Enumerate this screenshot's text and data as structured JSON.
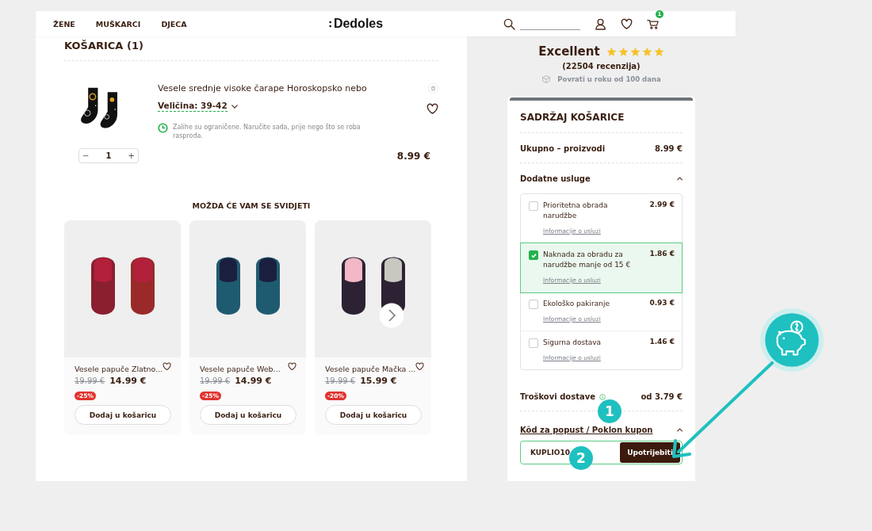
{
  "header": {
    "nav": [
      "ŽENE",
      "MUŠKARCI",
      "DJECA"
    ],
    "logo": "Dedoles",
    "cart_count": "1"
  },
  "cart": {
    "title": "KOŠARICA (1)",
    "item": {
      "name": "Vesele srednje visoke čarape Horoskopsko nebo",
      "size": "Veličina: 39-42",
      "stock_note": "Zalihe su ograničene. Naručite sada, prije nego što se roba rasproda.",
      "quantity": "1",
      "minus": "−",
      "plus": "+",
      "price": "8.99 €"
    }
  },
  "recommendations": {
    "title": "MOŽDA ĆE VAM SE SVIDJETI",
    "products": [
      {
        "name": "Vesele papuče Zlatno...",
        "old_price": "19.99 €",
        "price": "14.99 €",
        "discount": "-25%",
        "button": "Dodaj u košaricu"
      },
      {
        "name": "Vesele papuče Web...",
        "old_price": "19.99 €",
        "price": "14.99 €",
        "discount": "-25%",
        "button": "Dodaj u košaricu"
      },
      {
        "name": "Vesele papuče Mačka ...",
        "old_price": "19.99 €",
        "price": "15.99 €",
        "discount": "-20%",
        "button": "Dodaj u košaricu"
      }
    ]
  },
  "sidebar": {
    "rating": {
      "label": "Excellent",
      "stars": 5,
      "reviews": "(22504 recenzija)",
      "returns": "Povrati u roku od 100 dana"
    },
    "summary": {
      "title": "SADRŽAJ KOŠARICE",
      "subtotal_label": "Ukupno – proizvodi",
      "subtotal": "8.99 €",
      "services_label": "Dodatne usluge",
      "services_expanded": true,
      "services": [
        {
          "name": "Prioritetna obrada narudžbe",
          "price": "2.99 €",
          "info": "Informacije o usluzi",
          "checked": false
        },
        {
          "name": "Naknada za obradu za narudžbe manje od 15 €",
          "price": "1.86 €",
          "info": "Informacije o usluzi",
          "checked": true
        },
        {
          "name": "Ekološko pakiranje",
          "price": "0.93 €",
          "info": "Informacije o usluzi",
          "checked": false
        },
        {
          "name": "Sigurna dostava",
          "price": "1.46 €",
          "info": "Informacije o usluzi",
          "checked": false
        }
      ],
      "shipping_label": "Troškovi dostave",
      "shipping": "od 3.79 €",
      "coupon_label": "Kôd za popust / Poklon kupon",
      "coupon_expanded": true,
      "coupon_value": "KUPLIO10",
      "apply_button": "Upotrijebiti"
    }
  },
  "annotations": [
    "1",
    "2"
  ]
}
